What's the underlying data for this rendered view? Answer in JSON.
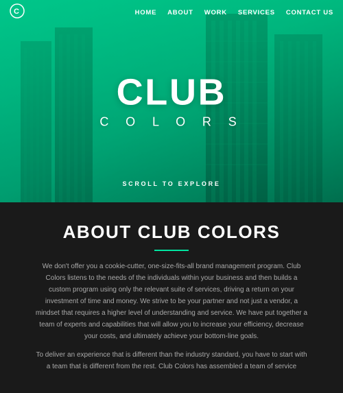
{
  "nav": {
    "logo_symbol": "C",
    "links": [
      {
        "label": "HOME",
        "name": "nav-home"
      },
      {
        "label": "ABOUT",
        "name": "nav-about"
      },
      {
        "label": "WORK",
        "name": "nav-work"
      },
      {
        "label": "SERVICES",
        "name": "nav-services"
      },
      {
        "label": "CONTACT US",
        "name": "nav-contact"
      }
    ]
  },
  "hero": {
    "title": "CLUB",
    "subtitle": "C O L O R S",
    "scroll_text": "SCROLL TO EXPLORE"
  },
  "about": {
    "title": "ABOUT CLUB COLORS",
    "paragraph1": "We don't offer you a cookie-cutter, one-size-fits-all brand management program. Club Colors listens to the needs of the individuals within your business and then builds a custom program using only the relevant suite of services, driving a return on your investment of time and money. We strive to be your partner and not just a vendor, a mindset that requires a higher level of understanding and service. We have put together a team of experts and capabilities that will allow you to increase your efficiency, decrease your costs, and ultimately achieve your bottom-line goals.",
    "paragraph2": "To deliver an experience that is different than the industry standard, you have to start with a team that is different from the rest. Club Colors has assembled a team of service"
  }
}
